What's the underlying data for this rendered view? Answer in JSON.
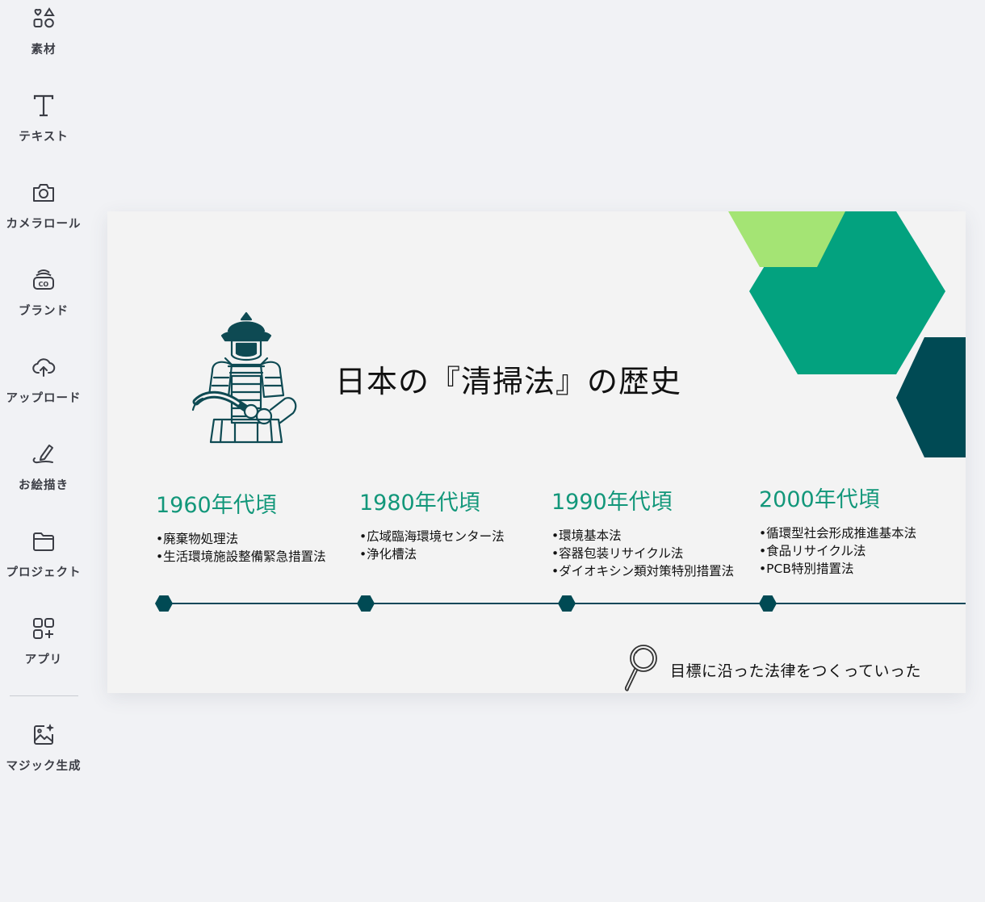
{
  "sidebar": {
    "items": [
      {
        "label": "素材",
        "icon": "elements-icon"
      },
      {
        "label": "テキスト",
        "icon": "text-icon"
      },
      {
        "label": "カメラロール",
        "icon": "camera-icon"
      },
      {
        "label": "ブランド",
        "icon": "brand-icon"
      },
      {
        "label": "アップロード",
        "icon": "cloud-upload-icon"
      },
      {
        "label": "お絵描き",
        "icon": "pen-draw-icon"
      },
      {
        "label": "プロジェクト",
        "icon": "folder-icon"
      },
      {
        "label": "アプリ",
        "icon": "apps-icon"
      },
      {
        "label": "マジック生成",
        "icon": "magic-image-icon"
      }
    ]
  },
  "slide": {
    "title": "日本の『清掃法』の歴史",
    "periods": [
      {
        "year": "1960年代頃",
        "items": [
          "•廃棄物処理法",
          "•生活環境施設整備緊急措置法"
        ]
      },
      {
        "year": "1980年代頃",
        "items": [
          "•広域臨海環境センター法",
          "•浄化槽法"
        ]
      },
      {
        "year": "1990年代頃",
        "items": [
          "•環境基本法",
          "•容器包装リサイクル法",
          "•ダイオキシン類対策特別措置法"
        ]
      },
      {
        "year": "2000年代頃",
        "items": [
          "•循環型社会形成推進基本法",
          "•食品リサイクル法",
          "•PCB特別措置法"
        ]
      }
    ],
    "footer": "目標に沿った法律をつくっていった"
  },
  "colors": {
    "accent_green": "#12977a",
    "hex_dark": "#004a54",
    "hex_mid": "#03a27f",
    "hex_light": "#a4e474",
    "line": "#10485a"
  }
}
